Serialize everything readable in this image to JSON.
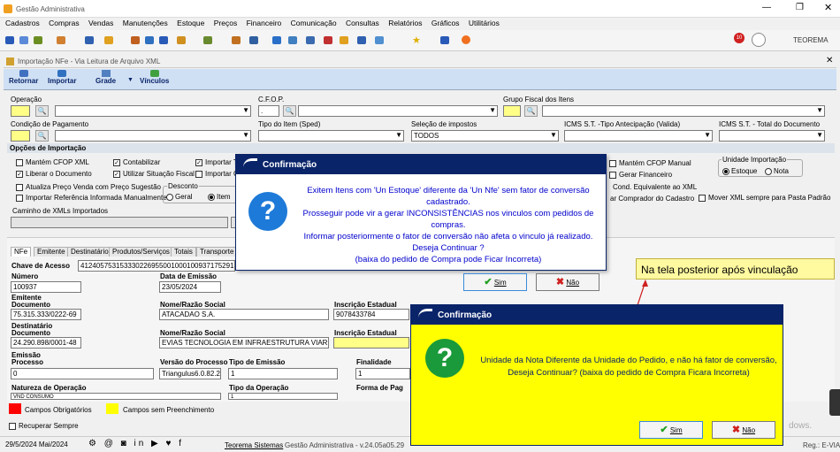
{
  "app": {
    "title": "Gestão Administrativa",
    "company": "TEOREMA",
    "badge": "10"
  },
  "menu": [
    "Cadastros",
    "Compras",
    "Vendas",
    "Manutenções",
    "Estoque",
    "Preços",
    "Financeiro",
    "Comunicação",
    "Consultas",
    "Relatórios",
    "Gráficos",
    "Utilitários"
  ],
  "child": {
    "title": "Importação NFe - Via Leitura de Arquivo XML"
  },
  "toolbar": {
    "retornar": "Retornar",
    "importar": "Importar",
    "grade": "Grade",
    "vinculos": "Vínculos"
  },
  "form": {
    "operacao": "Operação",
    "cfop": "C.F.O.P.",
    "cfop_value": ".",
    "grupo_fiscal": "Grupo Fiscal dos Itens",
    "condicao": "Condição de Pagamento",
    "tipo_item": "Tipo do Item (Sped)",
    "selecao": "Seleção de impostos",
    "selecao_value": "TODOS",
    "icms_antecip": "ICMS S.T. -Tipo Antecipação (Valida)",
    "icms_total": "ICMS S.T. - Total do Documento",
    "opcoes": "Opções de Importação",
    "mantem_cfop": "Mantém CFOP XML",
    "contabilizar": "Contabilizar",
    "importar_t": "Importar T",
    "liberar": "Liberar o Documento",
    "utilizar": "Utilizar Situação Fiscal",
    "importar_c": "Importar C",
    "atualiza": "Atualiza Preço Venda com Preço Sugestão",
    "referencia": "Importar Referência Informada Manualmente",
    "desconto": "Desconto",
    "geral": "Geral",
    "item": "Item",
    "mantem_manual": "Mantém CFOP Manual",
    "gerar_fin": "Gerar Financeiro",
    "cond_equiv": "Cond. Equivalente ao XML",
    "comprador": "ar Comprador do Cadastro",
    "unidade": "Unidade Importação",
    "estoque": "Estoque",
    "nota": "Nota",
    "mover": "Mover XML sempre para Pasta Padrão",
    "caminho": "Caminho de XMLs Importados"
  },
  "tabs": [
    "NFe",
    "Emitente",
    "Destinatário",
    "Produtos/Serviços",
    "Totais",
    "Transporte"
  ],
  "nfe": {
    "chave_lbl": "Chave de Acesso",
    "chave": "41240575315333022695500100010093717529188",
    "numero_lbl": "Número",
    "numero": "100937",
    "data_lbl": "Data de Emissão",
    "data": "23/05/2024",
    "emitente_lbl": "Emitente",
    "doc_lbl": "Documento",
    "doc": "75.315.333/0222-69",
    "nome_lbl": "Nome/Razão Social",
    "nome": "ATACADAO S.A.",
    "ie_lbl": "Inscrição Estadual",
    "ie": "9078433784",
    "dest_lbl": "Destinatário",
    "doc2": "24.290.898/0001-48",
    "nome2": "EVIAS TECNOLOGIA EM INFRAESTRUTURA VIAR N.F",
    "emissao_lbl": "Emissão",
    "processo_lbl": "Processo",
    "processo": "0",
    "versao_lbl": "Versão do Processo",
    "versao": "Triangulus6.0.82.22",
    "tipo_emissao_lbl": "Tipo de Emissão",
    "tipo_emissao": "1",
    "finalidade_lbl": "Finalidade",
    "finalidade": "1",
    "natureza_lbl": "Natureza de Operação",
    "natureza": "VND CONSUMO",
    "tipo_op_lbl": "Tipo da Operação",
    "tipo_op": "1",
    "forma_lbl": "Forma de Pag"
  },
  "legend": {
    "obrig": "Campos Obrigatórios",
    "sem": "Campos sem Preenchimento",
    "recuperar": "Recuperar Sempre"
  },
  "status": {
    "date": "29/5/2024 Mai/2024",
    "company": "Teorema Sistemas",
    "version": "Gestão Administrativa - v.24.05a05.29",
    "reg": "Reg.: E-VIA",
    "watermark": "dows."
  },
  "dialog1": {
    "title": "Confirmação",
    "text": [
      "Exitem Itens com 'Un Estoque' diferente da 'Un Nfe' sem fator de conversão cadastrado.",
      "Prosseguir pode vir a gerar INCONSISTÊNCIAS nos vinculos com pedidos de compras.",
      "Informar posteriormente o fator de conversão não afeta o vinculo já realizado. Deseja Continuar ?",
      "(baixa do pedido de Compra pode Ficar Incorreta)"
    ],
    "yes": "Sim",
    "no": "Não"
  },
  "annotation": "Na tela posterior após vinculação",
  "dialog2": {
    "title": "Confirmação",
    "text": "Unidade da Nota Diferente da Unidade do Pedido, e não há fator de conversão, Deseja Continuar? (baixa do pedido de Compra Ficara Incorreta)",
    "yes": "Sim",
    "no": "Não"
  },
  "colors": {
    "title_blue": "#0a246a",
    "dialog_text": "#0000cc",
    "highlight": "#ffff00",
    "annotation_bg": "#fff9a0",
    "required": "#ff0000"
  }
}
